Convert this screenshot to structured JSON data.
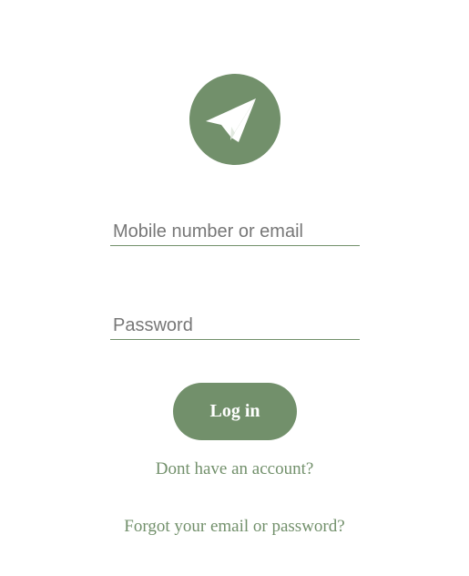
{
  "logo": {
    "icon": "paper-plane-icon",
    "color": "#72906b"
  },
  "form": {
    "username_placeholder": "Mobile number or email",
    "username_value": "",
    "password_placeholder": "Password",
    "password_value": "",
    "login_label": "Log in"
  },
  "links": {
    "signup": "Dont have an account?",
    "forgot": "Forgot your email or password?"
  },
  "colors": {
    "accent": "#72906b",
    "background": "#ffffff",
    "placeholder": "#777777"
  }
}
